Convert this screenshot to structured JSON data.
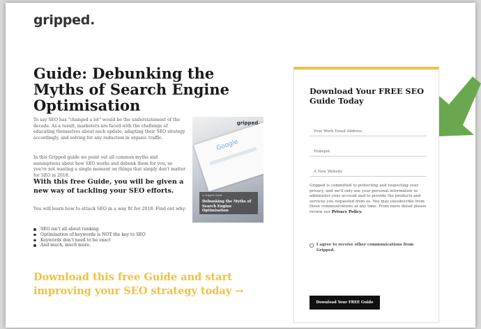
{
  "brand": {
    "logo_text": "gripped."
  },
  "page": {
    "title": "Guide: Debunking the Myths of Search Engine Optimisation",
    "intro_paragraph_1": "To say SEO has \"changed a lot\" would be the understatement of the decade. As a result, marketers are faced with the challenge of educating themselves about each update, adapting their SEO strategy accordingly, and solving for any reduction in organic traffic.",
    "intro_paragraph_2": "In this Gripped guide we point out all common myths and assumptions about how SEO works and debunk them for you, so you're not wasting a single moment on things that simply don't matter for SEO in 2018.",
    "highlight": "With this free Guide, you will be given a new way of tackling your SEO efforts.",
    "learn_intro": "You will learn how to attack SEO in a way fit for 2018. Find out why:",
    "bullets": [
      "SEO isn't all about ranking",
      "Optimisation of keywords is NOT the key to SEO",
      "Keywords don't need to be exact",
      "And much, much more."
    ],
    "cta": "Download this free Guide and start improving your SEO strategy today →"
  },
  "cover": {
    "logo": "gripped.",
    "search_text": "Google",
    "caption_small": "A Gripped Guide",
    "caption_title": "Debunking the Myths of Search Engine Optimisation"
  },
  "form": {
    "title": "Download Your FREE SEO Guide Today",
    "email_placeholder": "Your Work Email Address",
    "company_placeholder": "Hubspot",
    "website_placeholder": "A New Website",
    "privacy_text": "Gripped is committed to protecting and respecting your privacy, and we'll only use your personal information to administer your account and to provide the products and services you requested from us. You may unsubscribe from these communications at any time. From more detail please review our",
    "privacy_link": "Privacy Policy.",
    "consent_label": "I agree to receive other communications from Gripped.",
    "submit_label": "Download Your FREE Guide"
  },
  "colors": {
    "accent": "#f2c23a",
    "arrow": "#6aa84f",
    "button": "#111111"
  },
  "icons": {
    "arrow": "green-down-left-arrow-icon"
  }
}
